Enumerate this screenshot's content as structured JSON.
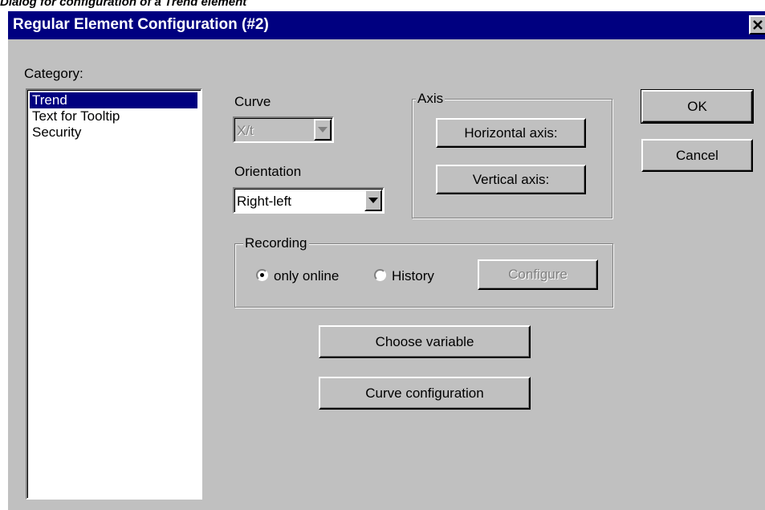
{
  "caption": "Dialog for configuration of a Trend element",
  "window": {
    "title": "Regular Element Configuration (#2)",
    "close_icon": "close-icon"
  },
  "category": {
    "label": "Category:",
    "items": [
      "Trend",
      "Text for Tooltip",
      "Security"
    ],
    "selected": "Trend"
  },
  "curve": {
    "label": "Curve",
    "value": "X/t",
    "enabled": false
  },
  "orientation": {
    "label": "Orientation",
    "value": "Right-left"
  },
  "axis": {
    "label": "Axis",
    "horizontal_button": "Horizontal axis:",
    "vertical_button": "Vertical axis:"
  },
  "recording": {
    "label": "Recording",
    "options": [
      "only online",
      "History"
    ],
    "selected": "only online",
    "configure_button": "Configure",
    "configure_enabled": false
  },
  "buttons": {
    "ok": "OK",
    "cancel": "Cancel",
    "choose_variable": "Choose variable",
    "curve_configuration": "Curve configuration"
  },
  "colors": {
    "face": "#c0c0c0",
    "titlebar": "#000080",
    "selection": "#000080"
  }
}
